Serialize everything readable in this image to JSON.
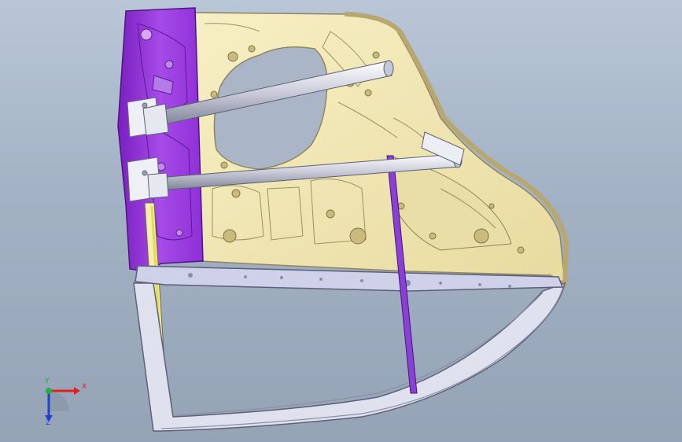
{
  "viewport": {
    "background_top": "#b8c6d8",
    "background_bottom": "#95a3b6"
  },
  "model": {
    "colors": {
      "inner_panel": "#f3e9b4",
      "inner_panel_edge": "#8f8660",
      "hinge_reinforcement": "#9a2fe0",
      "guide_rail": "#8a3fd6",
      "belt_line": "#c9cbe4",
      "window_frame": "#d9dbec",
      "seal_strip": "#e4dc4a",
      "tube": "#d8dae6"
    }
  },
  "triad": {
    "x_label": "X",
    "y_label": "Y",
    "z_label": "Z",
    "x_color": "#e02020",
    "y_color": "#20b040",
    "z_color": "#2040d0"
  }
}
